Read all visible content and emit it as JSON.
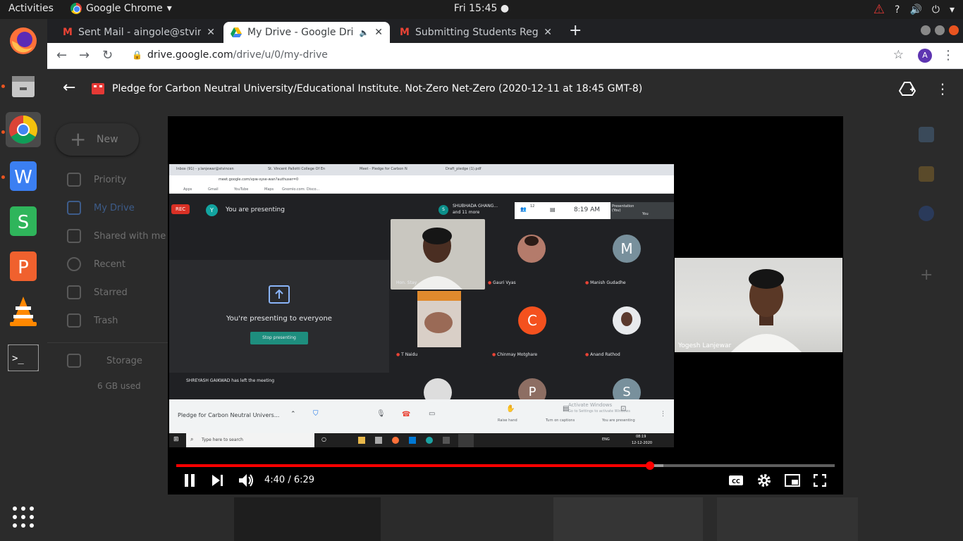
{
  "topbar": {
    "activities": "Activities",
    "app_name": "Google Chrome",
    "clock": "Fri 15:45"
  },
  "browser": {
    "tabs": [
      {
        "title": "Sent Mail - aingole@stvincentngp.edu.in",
        "icon": "gmail-icon"
      },
      {
        "title": "My Drive - Google Drive",
        "icon": "drive-icon",
        "active": true
      },
      {
        "title": "Submitting Students Registration",
        "icon": "gmail-icon"
      }
    ],
    "url_host": "drive.google.com",
    "url_path": "/drive/u/0/my-drive",
    "profile_initial": "A"
  },
  "drive": {
    "new_label": "New",
    "nav": [
      {
        "label": "Priority",
        "icon": "priority-icon"
      },
      {
        "label": "My Drive",
        "icon": "my-drive-icon"
      },
      {
        "label": "Shared with me",
        "icon": "shared-icon"
      },
      {
        "label": "Recent",
        "icon": "recent-icon"
      },
      {
        "label": "Starred",
        "icon": "star-icon"
      },
      {
        "label": "Trash",
        "icon": "trash-icon"
      }
    ],
    "storage_label": "Storage",
    "storage_used": "6 GB used"
  },
  "viewer": {
    "title": "Pledge for Carbon Neutral University/Educational Institute. Not-Zero Net-Zero (2020-12-11 at 18:45 GMT-8)"
  },
  "meet": {
    "tabs": [
      "Inbox (91) - y.lanjewar@stvincen",
      "St. Vincent Pallotti College Of En",
      "Meet - Pledge for Carbon N",
      "Draft_pledge (1).pdf"
    ],
    "url": "meet.google.com/vpw-syse-wan?authuser=0",
    "bookmarks": [
      "Apps",
      "Gmail",
      "YouTube",
      "Maps",
      "Gnomio.com: Disco..."
    ],
    "rec": "REC",
    "presenting": "You are presenting",
    "presenter_initial": "Y",
    "shubhada": "SHUBHADA GHANG...",
    "others": "and 11 more",
    "participants_count": "12",
    "meet_time": "8:19 AM",
    "presentation_label": "Presentation (You)",
    "you_label": "You",
    "presenting_everyone": "You're presenting to everyone",
    "stop_presenting": "Stop presenting",
    "left_notice": "SHREYASH GAIKWAD has left the meeting",
    "tiles": [
      {
        "name": "Hon. Stay"
      },
      {
        "name": "Gauri Vyas"
      },
      {
        "name": "Manish Gudadhe",
        "initial": "M"
      },
      {
        "name": "T Naidu"
      },
      {
        "name": "Chinmay Motghare",
        "initial": "C"
      },
      {
        "name": "Anand Rathod"
      },
      {
        "name": ""
      },
      {
        "name": "",
        "initial": "P"
      },
      {
        "name": "",
        "initial": "S"
      }
    ],
    "meeting_title": "Pledge for Carbon Neutral Univers...",
    "raise_hand": "Raise hand",
    "captions": "Turn on captions",
    "you_presenting": "You are presenting",
    "activate": "Activate Windows",
    "activate_sub": "Go to Settings to activate Windows",
    "search": "Type here to search",
    "tray_time": "08:19",
    "tray_date": "12-12-2020",
    "lang": "ENG"
  },
  "self_cam": {
    "name": "Yogesh Lanjewar"
  },
  "player": {
    "time": "4:40 / 6:29",
    "progress": 0.72,
    "buffered": 0.74
  }
}
